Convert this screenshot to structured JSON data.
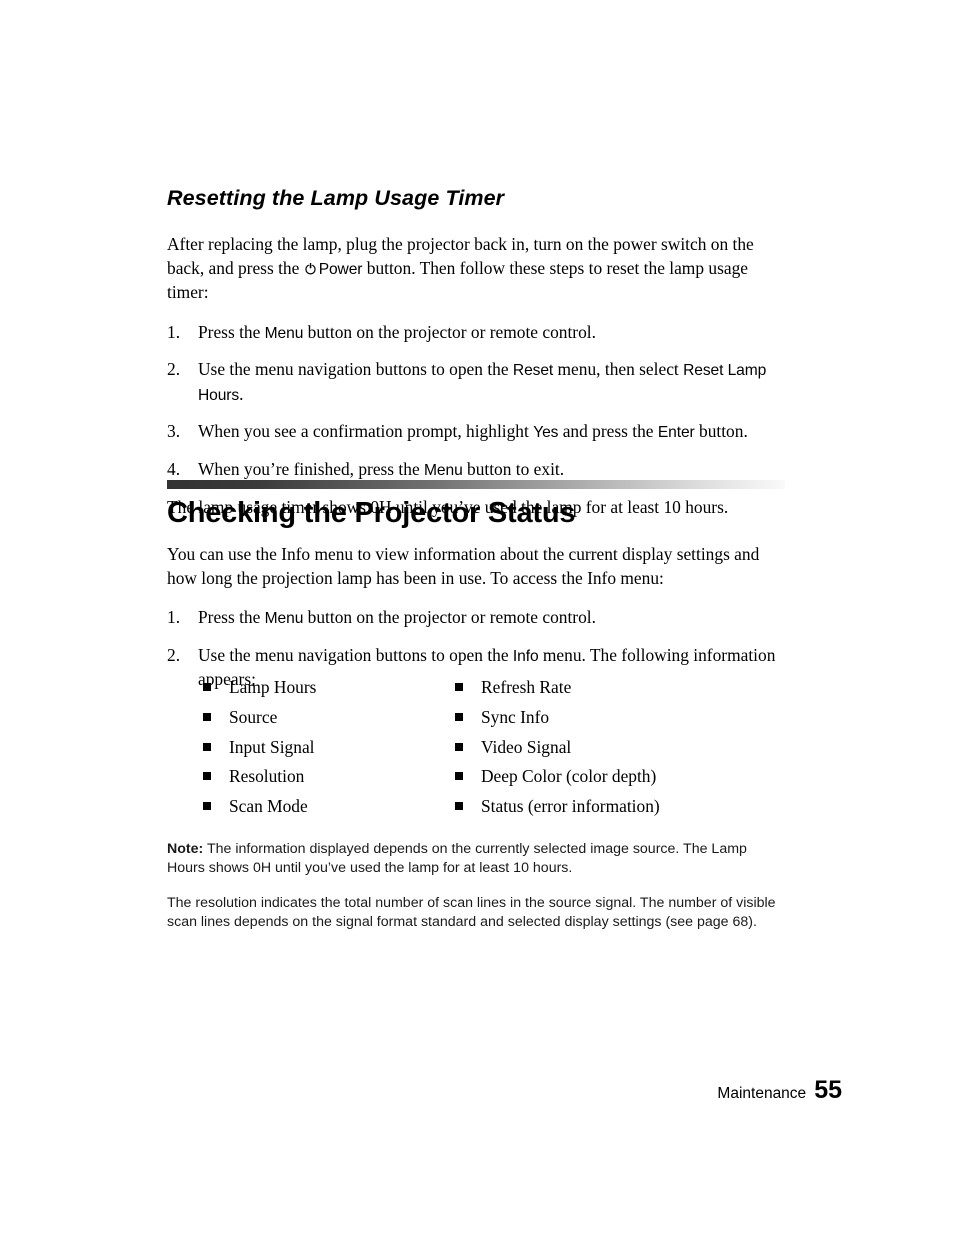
{
  "section_one": {
    "heading": "Resetting the Lamp Usage Timer",
    "intro_part1": "After replacing the lamp, plug the projector back in, turn on the power switch on the back, and press the",
    "power_icon": "power-icon",
    "power_label": "Power",
    "intro_part2": "button. Then follow these steps to reset the lamp usage timer:",
    "steps": [
      {
        "num": "1.",
        "part1": "Press the",
        "kbd1": "Menu",
        "part2": "button on the projector or remote control.",
        "kbd2": "",
        "part3": ""
      },
      {
        "num": "2.",
        "part1": "Use the menu navigation buttons to open the",
        "kbd1": "Reset",
        "part2": "menu, then select",
        "kbd2": "Reset Lamp Hours",
        "part3": "."
      },
      {
        "num": "3.",
        "part1": "When you see a confirmation prompt, highlight",
        "kbd1": "Yes",
        "part2": "and press the",
        "kbd2": "Enter",
        "part3": "button."
      },
      {
        "num": "4.",
        "part1": "When you’re finished, press the",
        "kbd1": "Menu",
        "part2": "button to exit.",
        "kbd2": "",
        "part3": ""
      }
    ],
    "closing": "The lamp usage timer shows 0H until you’ve used the lamp for at least 10 hours."
  },
  "section_two": {
    "heading": "Checking the Projector Status",
    "rule_gradient_start": "#333333",
    "rule_gradient_end": "#fafafa",
    "intro": "You can use the Info menu to view information about the current display settings and how long the projection lamp has been in use. To access the Info menu:",
    "steps": [
      {
        "num": "1.",
        "part1": "Press the",
        "kbd1": "Menu",
        "part2": "button on the projector or remote control."
      },
      {
        "num": "2.",
        "part1": "Use the menu navigation buttons to open the",
        "kbd1": "Info",
        "part2": "menu. The following information appears:"
      }
    ],
    "info_items": [
      {
        "left": "Lamp Hours",
        "right": "Refresh Rate"
      },
      {
        "left": "Source",
        "right": "Sync Info"
      },
      {
        "left": "Input Signal",
        "right": "Video Signal"
      },
      {
        "left": "Resolution",
        "right": "Deep Color (color depth)"
      },
      {
        "left": "Scan Mode",
        "right": "Status (error information)"
      }
    ],
    "note": {
      "label": "Note:",
      "text": "The information displayed depends on the currently selected image source. The Lamp Hours shows 0H until you’ve used the lamp for at least 10 hours.",
      "paragraph2": "The resolution indicates the total number of scan lines in the source signal. The number of visible scan lines depends on the signal format standard and selected display settings (see page 68)."
    }
  },
  "footer": {
    "section": "Maintenance",
    "page_number": "55"
  }
}
